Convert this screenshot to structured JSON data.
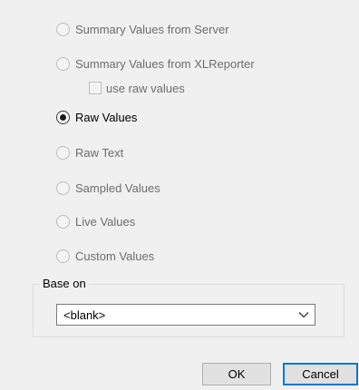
{
  "options": [
    {
      "label": "Summary Values from Server",
      "enabled": false,
      "checked": false
    },
    {
      "label": "Summary Values from XLReporter",
      "enabled": false,
      "checked": false
    },
    {
      "label": "Raw Values",
      "enabled": true,
      "checked": true
    },
    {
      "label": "Raw Text",
      "enabled": false,
      "checked": false
    },
    {
      "label": "Sampled Values",
      "enabled": false,
      "checked": false
    },
    {
      "label": "Live Values",
      "enabled": false,
      "checked": false
    },
    {
      "label": "Custom Values",
      "enabled": false,
      "checked": false
    }
  ],
  "raw_values_checkbox": {
    "label": "use raw values",
    "checked": false,
    "enabled": false
  },
  "base_on": {
    "legend": "Base on",
    "selected": "<blank>"
  },
  "buttons": {
    "ok": "OK",
    "cancel": "Cancel"
  },
  "colors": {
    "accent": "#0078d7",
    "disabled_text": "#6d6d6d"
  }
}
